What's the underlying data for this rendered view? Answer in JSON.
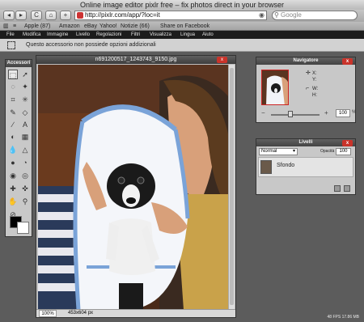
{
  "browser": {
    "window_title": "Online image editor pixlr free – fix photos direct in your browser",
    "url": "http://pixlr.com/app/?loc=it",
    "search_placeholder": "Google",
    "nav_buttons": [
      "◂",
      "▸",
      "C",
      "⌂",
      "+"
    ],
    "bookmarks": [
      "Apple (87)",
      "Amazon",
      "eBay",
      "Yahoo!",
      "Notizie (66)",
      "Share on Facebook"
    ]
  },
  "menu": [
    "File",
    "Modifica",
    "Immagine",
    "Livello",
    "Regolazioni",
    "Filtri",
    "Visualizza",
    "Lingua",
    "Aiuto"
  ],
  "options_bar": {
    "message": "Questo accessorio non possiede opzioni addizionali"
  },
  "tools_panel": {
    "title": "Accessori"
  },
  "image_window": {
    "filename": "n691200517_1243743_9150.jpg",
    "close": "x",
    "zoom": "100%",
    "dimensions": "453x604 px"
  },
  "navigator": {
    "title": "Navigatore",
    "close": "x",
    "x_label": "X:",
    "y_label": "Y:",
    "w_label": "W:",
    "h_label": "H:",
    "zoom_value": "100",
    "zoom_unit": "%",
    "zoom_minus": "−",
    "zoom_plus": "+",
    "slider_fraction": 0.4
  },
  "layers": {
    "title": "Livelli",
    "close": "x",
    "blend_mode": "Normal",
    "opacity_label": "Opacità",
    "opacity_value": "100",
    "layer_name": "Sfondo"
  },
  "status": {
    "fps": "48 FPS   17.86 MB"
  },
  "colors": {
    "foreground": "#000000",
    "background": "#ffffff",
    "accent_close": "#c9332a"
  }
}
